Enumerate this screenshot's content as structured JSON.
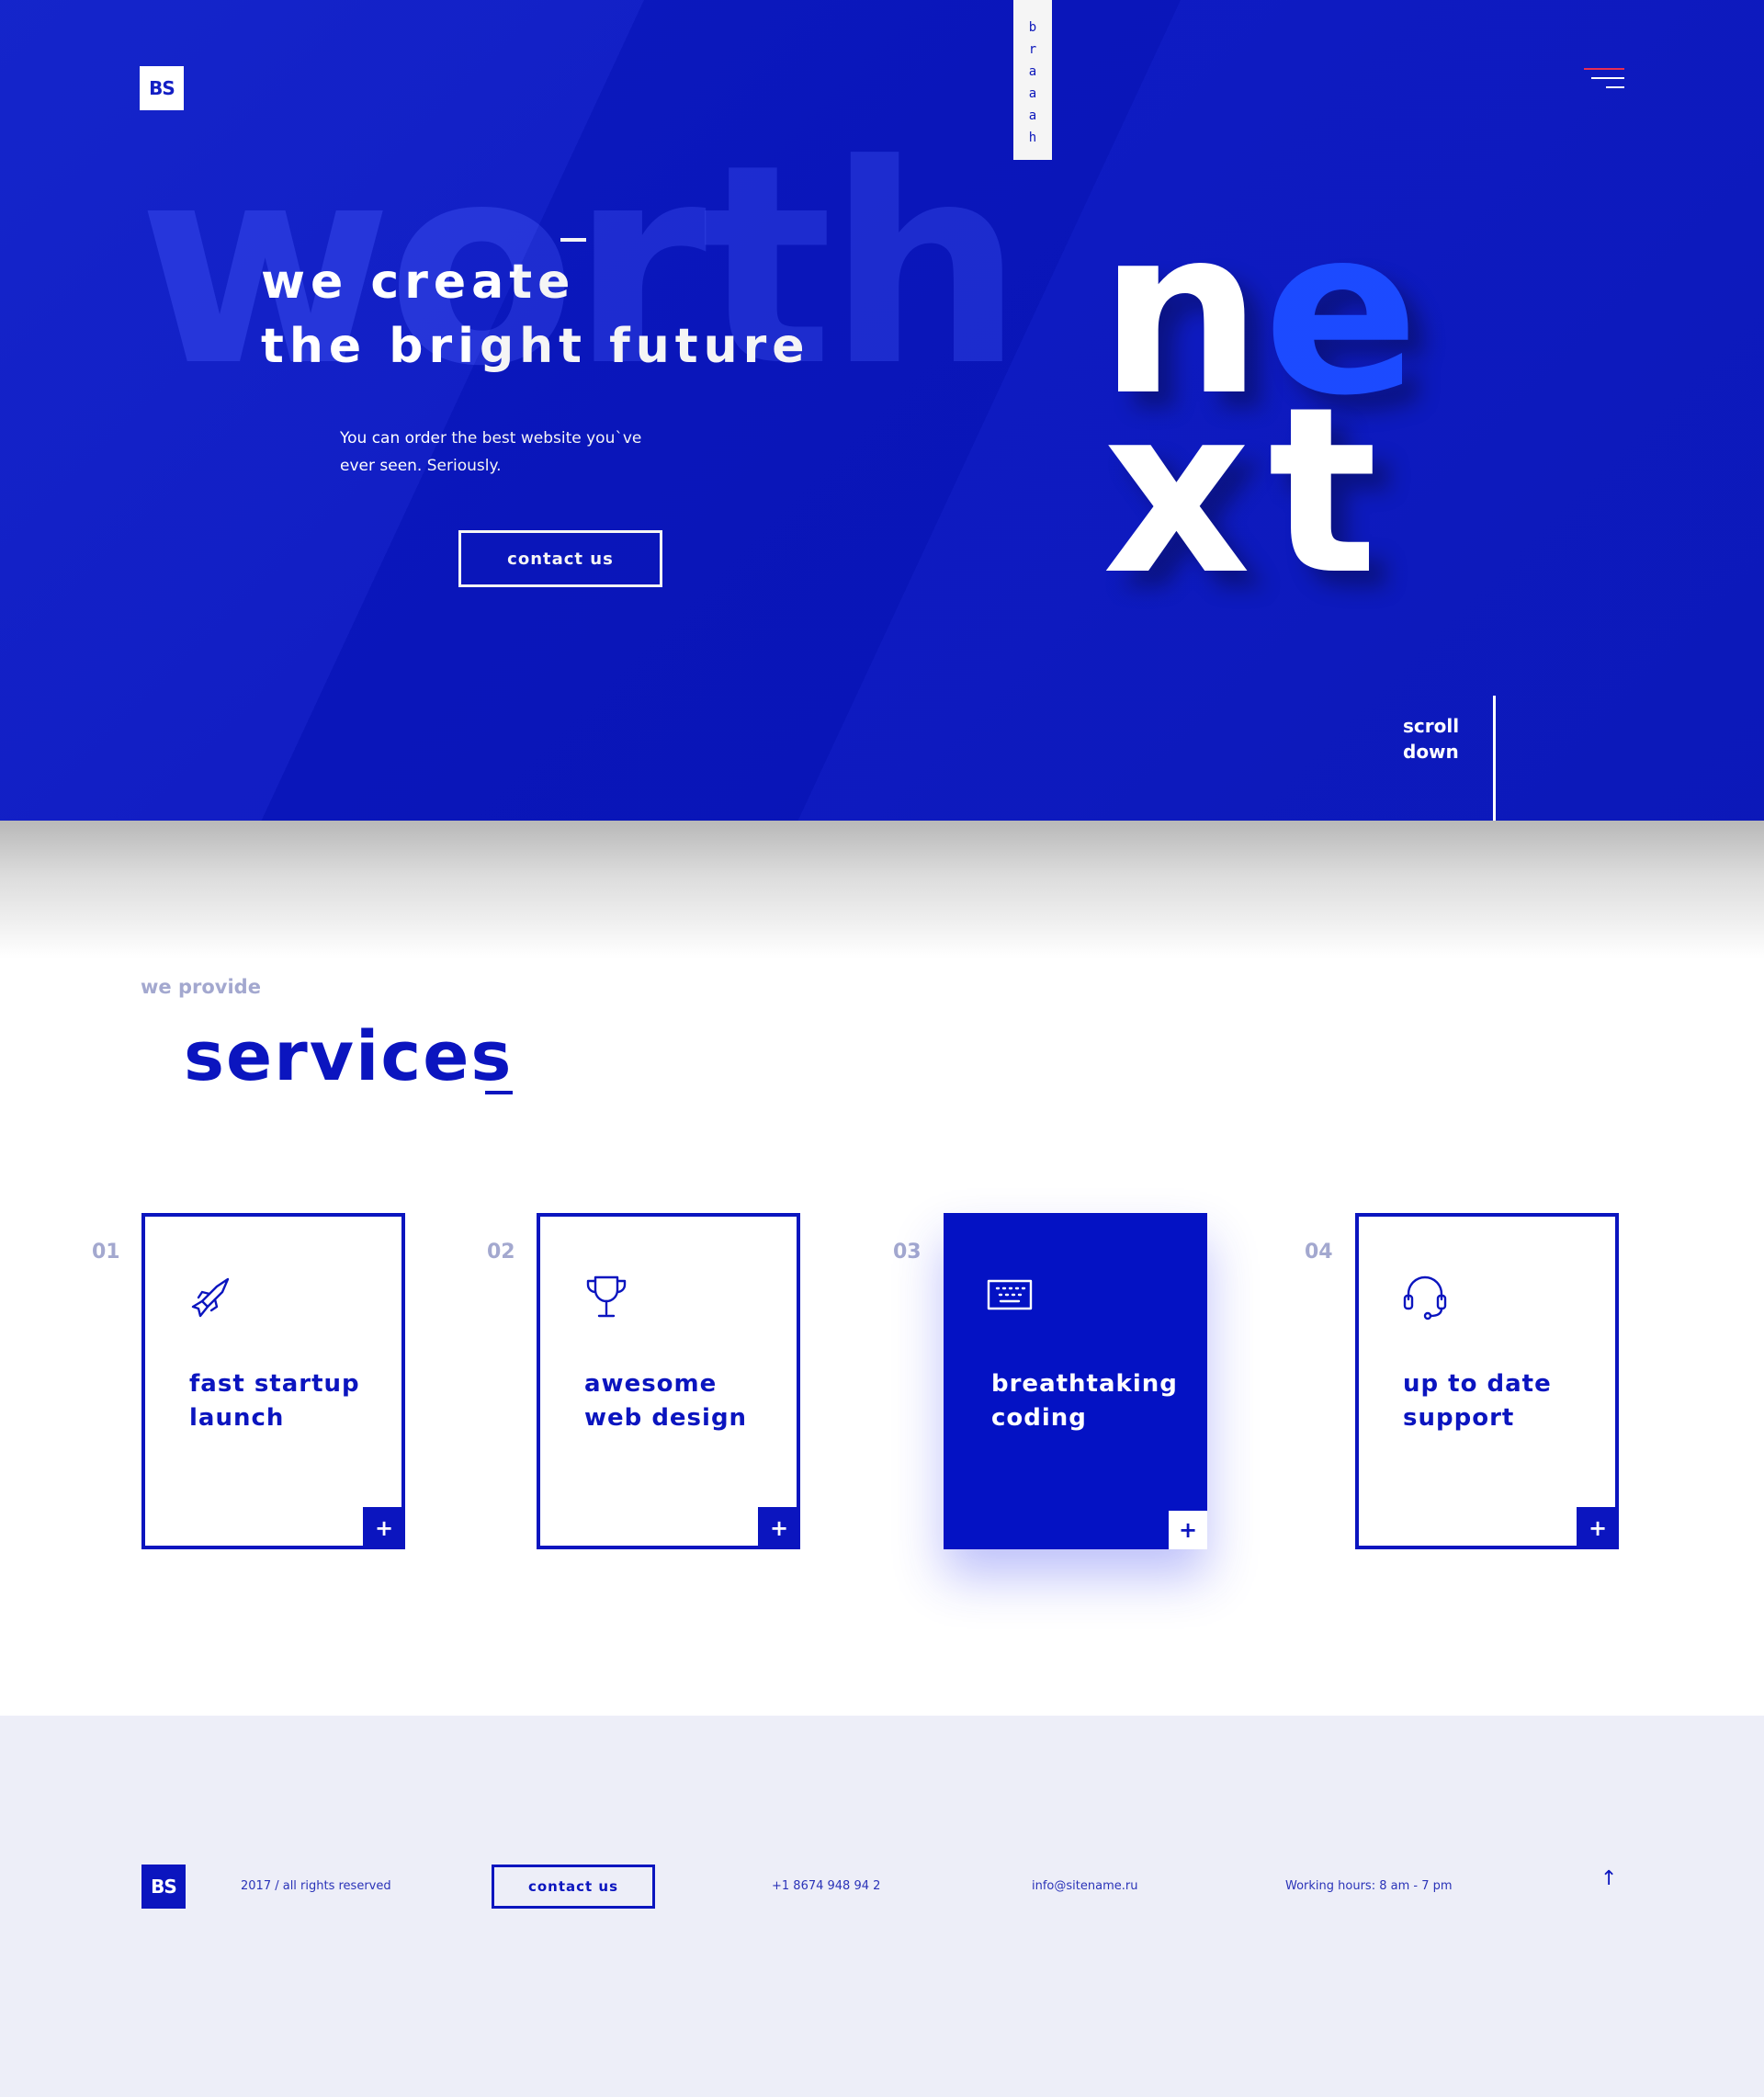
{
  "header": {
    "logo": "BS",
    "brand_letters": [
      "b",
      "r",
      "a",
      "a",
      "a",
      "h"
    ]
  },
  "hero": {
    "bg_word": "worth",
    "title_line1": "we create",
    "title_line2": "the bright future",
    "subtitle": "You can order the best website you`ve ever seen. Seriously.",
    "cta_label": "contact us",
    "big_letters": [
      "n",
      "e",
      "x",
      "t"
    ],
    "scroll_line1": "scroll",
    "scroll_line2": "down"
  },
  "services": {
    "kicker": "we provide",
    "title": "services",
    "cards": [
      {
        "num": "01",
        "title": "fast startup\nlaunch",
        "icon": "rocket-icon"
      },
      {
        "num": "02",
        "title": "awesome\nweb design",
        "icon": "trophy-icon"
      },
      {
        "num": "03",
        "title": "breathtaking\ncoding",
        "icon": "keyboard-icon"
      },
      {
        "num": "04",
        "title": "up to date\nsupport",
        "icon": "headset-icon"
      }
    ],
    "plus_label": "+"
  },
  "footer": {
    "logo": "BS",
    "copyright": "2017 / all rights reserved",
    "cta_label": "contact us",
    "phone": "+1 8674 948 94 2",
    "email": "info@sitename.ru",
    "hours": "Working hours: 8 am - 7 pm",
    "up_arrow": "↑"
  },
  "colors": {
    "brand_blue": "#0b15bf",
    "accent_blue": "#1747ff",
    "menu_accent": "#e6294f",
    "footer_bg": "#edeef8"
  }
}
